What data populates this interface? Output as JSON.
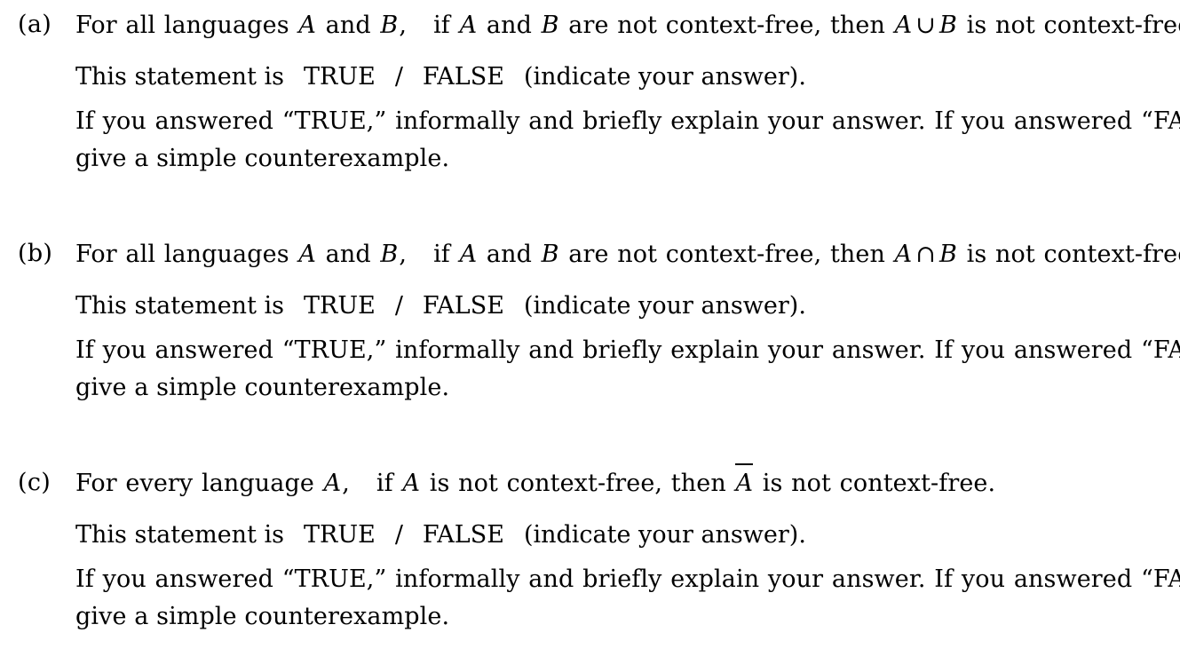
{
  "document": {
    "type": "homework-problem-set",
    "items": [
      {
        "label": "(a)",
        "statement_part1": "For all languages",
        "var_A": "A",
        "and_word": "and",
        "var_B": "B",
        "comma": ",",
        "statement_part2": "if",
        "var_A2": "A",
        "and_word2": "and",
        "var_B2": "B",
        "statement_part3": "are not context-free, then",
        "expr_left": "A",
        "operator": "∪",
        "expr_right": "B",
        "statement_part4": "is not context-free.",
        "tf_prompt": "This statement is",
        "true_label": "TRUE",
        "separator": "/",
        "false_label": "FALSE",
        "tf_suffix": "(indicate your answer).",
        "explain_line": "If you answered “TRUE,” informally and briefly explain your answer.  If you answered “FALSE,” give a simple counterexample."
      },
      {
        "label": "(b)",
        "statement_part1": "For all languages",
        "var_A": "A",
        "and_word": "and",
        "var_B": "B",
        "comma": ",",
        "statement_part2": "if",
        "var_A2": "A",
        "and_word2": "and",
        "var_B2": "B",
        "statement_part3": "are not context-free, then",
        "expr_left": "A",
        "operator": "∩",
        "expr_right": "B",
        "statement_part4": "is not context-free.",
        "tf_prompt": "This statement is",
        "true_label": "TRUE",
        "separator": "/",
        "false_label": "FALSE",
        "tf_suffix": "(indicate your answer).",
        "explain_line": "If you answered “TRUE,” informally and briefly explain your answer.  If you answered “FALSE,” give a simple counterexample."
      },
      {
        "label": "(c)",
        "statement_part1": "For every language",
        "var_A": "A",
        "comma": ",",
        "statement_part2": "if",
        "var_A2": "A",
        "statement_part3": "is not context-free, then",
        "complement_var": "A",
        "statement_part4": "is not context-free.",
        "tf_prompt": "This statement is",
        "true_label": "TRUE",
        "separator": "/",
        "false_label": "FALSE",
        "tf_suffix": "(indicate your answer).",
        "explain_line": "If you answered “TRUE,” informally and briefly explain your answer.  If you answered “FALSE,” give a simple counterexample."
      }
    ]
  }
}
